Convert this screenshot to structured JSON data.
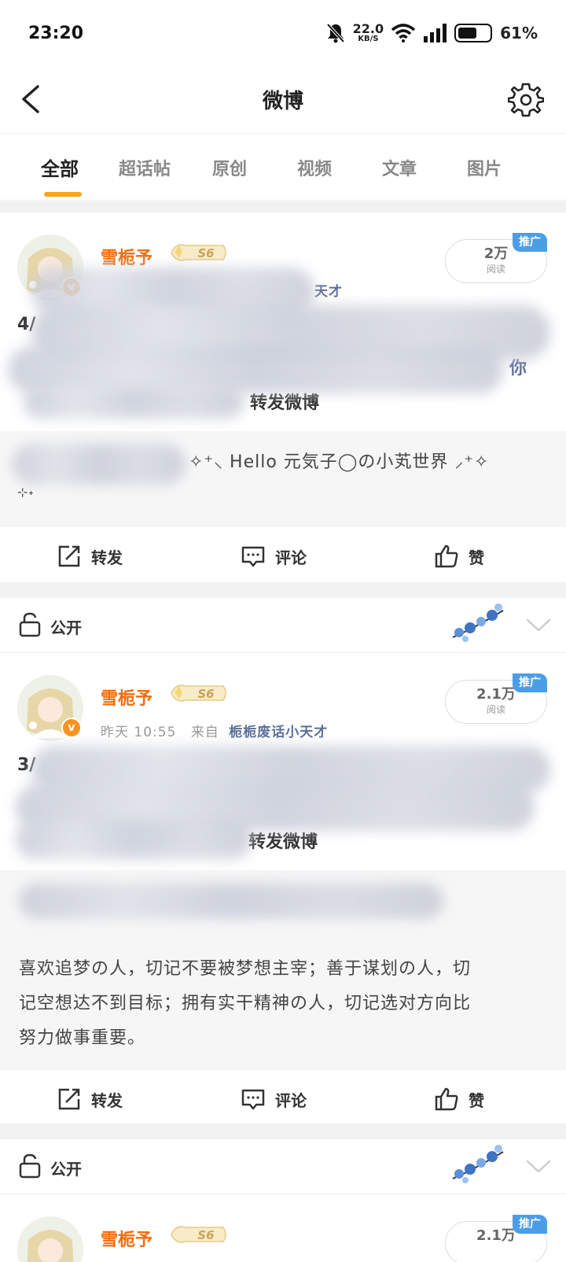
{
  "status_bar": {
    "time": "23:20",
    "net_speed": "22.0",
    "net_unit": "KB/S",
    "battery": "61%",
    "battery_level": 0.61,
    "icons": [
      "mute-bell-icon",
      "wifi-icon",
      "signal-icon",
      "battery-icon"
    ]
  },
  "header": {
    "title": "微博",
    "back_icon": "chevron-left-icon",
    "settings_icon": "gear-icon"
  },
  "tabs": [
    {
      "label": "全部",
      "active": true
    },
    {
      "label": "超话帖"
    },
    {
      "label": "原创"
    },
    {
      "label": "视频"
    },
    {
      "label": "文章"
    },
    {
      "label": "图片"
    }
  ],
  "accent": "#f7a51b",
  "posts": [
    {
      "username": "雪栀予",
      "level": "S6",
      "meta_source": "天才",
      "read_count": "2万",
      "read_label": "阅读",
      "promo": "推广",
      "content_prefix": "4/",
      "content_end": "转发微博",
      "content_fragment": "你",
      "repost_text": "✧⁺⸜ Hello 元気子◯の小芄世界 ⸝⁺✧",
      "repost_text2": "⊹˖",
      "actions": {
        "repost": "转发",
        "comment": "评论",
        "like": "赞"
      },
      "privacy": "公开"
    },
    {
      "username": "雪栀予",
      "level": "S6",
      "meta_time": "昨天  10:55",
      "meta_from": "来自",
      "meta_source": "栀栀废话小天才",
      "read_count": "2.1万",
      "read_label": "阅读",
      "promo": "推广",
      "content_prefix": "3/",
      "content_end": "转发微博",
      "repost_lines": [
        "喜欢追梦の人，切记不要被梦想主宰；善于谋划の人，切",
        "记空想达不到目标；拥有实干精神の人，切记选对方向比",
        "努力做事重要。"
      ],
      "actions": {
        "repost": "转发",
        "comment": "评论",
        "like": "赞"
      },
      "privacy": "公开"
    },
    {
      "username": "雪栀予",
      "level": "S6",
      "read_count": "2.1万",
      "promo": "推广"
    }
  ]
}
